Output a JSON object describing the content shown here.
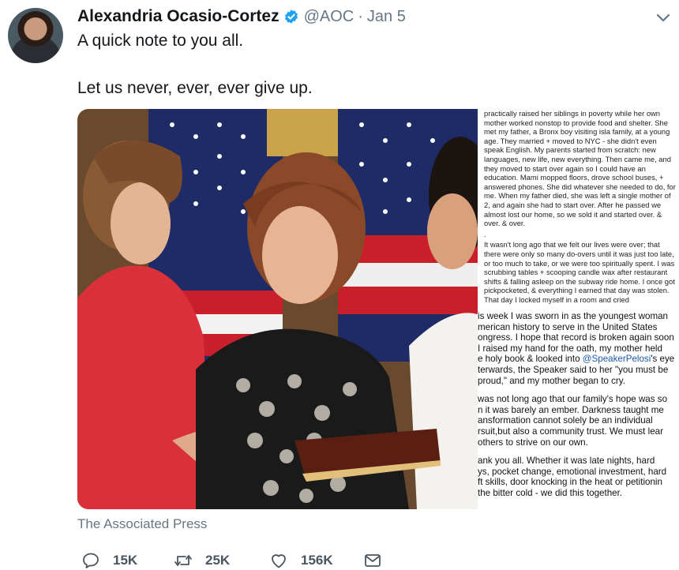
{
  "tweet": {
    "author_name": "Alexandria Ocasio-Cortez",
    "handle": "@AOC",
    "separator": "·",
    "date": "Jan 5",
    "text_line1": "A quick note to you all.",
    "text_line2": "Let us never, ever, ever give up.",
    "media_source": "The Associated Press"
  },
  "note_top": [
    "practically raised her siblings in poverty while her own mother worked nonstop to provide food and shelter. She met my father, a Bronx boy visiting isla family, at a young age. They married + moved to NYC - she didn't even speak English. My parents started from scratch: new languages, new life, new everything. Then came me, and they moved to start over again so I could have an education. Mami mopped floors, drove school buses, + answered phones. She did whatever she needed to do, for me. When my father died, she was left a single mother of 2, and again she had to start over. After he passed we almost lost our home, so we sold it and started over. & over. & over.",
    ".",
    "It wasn't long ago that we felt our lives were over; that there were only so many do-overs until it was just too late, or too much to take, or we were too spiritually spent. I was scrubbing tables + scooping candle wax after restaurant shifts & falling asleep on the subway ride home. I once got pickpocketed, & everything I earned that day was stolen. That day I locked myself in a room and cried"
  ],
  "note_bottom": {
    "p1_lines": [
      "is week I was sworn in as the youngest woman",
      "merican history to serve in the United States",
      "ongress. I hope that record is broken again soon",
      "I raised my hand for the oath, my mother held"
    ],
    "p1_l5_before": "e holy book & looked into ",
    "p1_l5_mention": "@SpeakerPelosi",
    "p1_l5_after": "'s eye",
    "p1_lines_end": [
      "terwards, the Speaker said to her \"you must be",
      "proud,\" and my mother began to cry."
    ],
    "p2_lines": [
      "was not long ago that our family's hope was so",
      "n it was barely an ember. Darkness taught me",
      "ansformation cannot solely be an individual",
      "rsuit,but also a community trust. We must lear",
      "others to strive on our own."
    ],
    "p3_lines": [
      "ank you all. Whether it was late nights, hard",
      "ys, pocket change, emotional investment, hard",
      "ft skills, door knocking in the heat or petitionin",
      "the bitter cold - we did this together."
    ]
  },
  "actions": {
    "reply_count": "15K",
    "retweet_count": "25K",
    "like_count": "156K"
  },
  "icons": {
    "verified": "verified-badge-icon",
    "caret": "chevron-down-icon",
    "reply": "reply-icon",
    "retweet": "retweet-icon",
    "like": "heart-icon",
    "dm": "envelope-icon"
  },
  "colors": {
    "verified_blue": "#1da1f2",
    "meta_gray": "#657786",
    "mention_blue": "#1b5aa8"
  }
}
